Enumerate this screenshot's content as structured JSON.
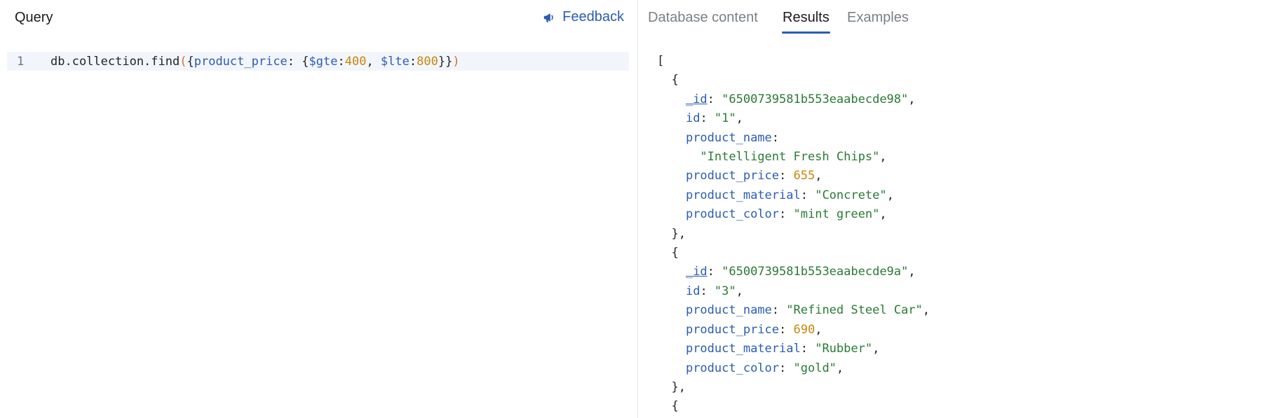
{
  "query_panel": {
    "title": "Query",
    "feedback_label": "Feedback",
    "feedback_icon": "megaphone-icon",
    "editor": {
      "line_number": "1",
      "tokens": {
        "t1": "db.collection.find",
        "t2": "(",
        "t3": "{",
        "t4": "product_price",
        "t5": ": {",
        "t6": "$gte",
        "t7": ":",
        "t8": "400",
        "t9": ", ",
        "t10": "$lte",
        "t11": ":",
        "t12": "800",
        "t13": "}}",
        "t14": ")"
      }
    }
  },
  "tabs": {
    "database_content": "Database content",
    "results": "Results",
    "examples": "Examples",
    "active": "results"
  },
  "results": {
    "open_bracket": "[",
    "open_brace": "{",
    "close_brace": "},",
    "colon": ": ",
    "comma": ",",
    "keys": {
      "_id": "_id",
      "id": "id",
      "product_name": "product_name",
      "product_price": "product_price",
      "product_material": "product_material",
      "product_color": "product_color"
    },
    "docs": [
      {
        "_id": "\"6500739581b553eaabecde98\"",
        "id": "\"1\"",
        "product_name": "\"Intelligent Fresh Chips\"",
        "product_price": "655",
        "product_material": "\"Concrete\"",
        "product_color": "\"mint green\""
      },
      {
        "_id": "\"6500739581b553eaabecde9a\"",
        "id": "\"3\"",
        "product_name": "\"Refined Steel Car\"",
        "product_price": "690",
        "product_material": "\"Rubber\"",
        "product_color": "\"gold\""
      }
    ]
  },
  "colors": {
    "accent": "#2a5db0",
    "string": "#2a7a35",
    "number": "#c8860a",
    "paren": "#d56a32",
    "editor_line_bg": "#f2f6fc"
  }
}
